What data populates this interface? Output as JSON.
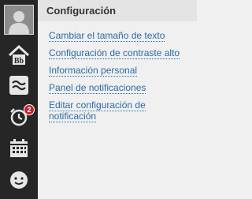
{
  "panel": {
    "title": "Configuración"
  },
  "menu": {
    "items": [
      {
        "label": "Cambiar el tamaño de texto"
      },
      {
        "label": "Configuración de contraste alto"
      },
      {
        "label": "Información personal"
      },
      {
        "label": "Panel de notificaciones"
      },
      {
        "label": "Editar configuración de notificación"
      }
    ]
  },
  "rail": {
    "icons": [
      "avatar",
      "bb-home-icon",
      "stream-icon",
      "alarm-clock-icon",
      "calendar-icon",
      "smiley-icon"
    ],
    "notification_count": "2"
  },
  "colors": {
    "rail_bg": "#262626",
    "header_bg": "#e4e4e4",
    "panel_bg": "#f0f0f0",
    "link": "#2a6aa6",
    "badge": "#c8202f"
  }
}
